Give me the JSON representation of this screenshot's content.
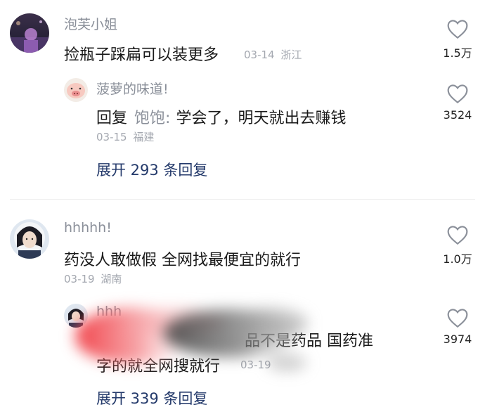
{
  "comments": [
    {
      "username": "泡芙小姐",
      "text": "捡瓶子踩扁可以装更多",
      "date": "03-14",
      "location": "浙江",
      "likes": "1.5万",
      "reply": {
        "username": "菠萝的味道!",
        "reply_label": "回复",
        "reply_to": "饱饱:",
        "text": "学会了，明天就出去赚钱",
        "date": "03-15",
        "location": "福建",
        "likes": "3524"
      },
      "expand_label": "展开 293 条回复"
    },
    {
      "username": "hhhhh!",
      "text": "药没人敢做假 全网找最便宜的就行",
      "date": "03-19",
      "location": "湖南",
      "likes": "1.0万",
      "reply": {
        "username_partial": "hhh",
        "line1_visible": "品不是药品 国药准",
        "line2_visible": "字的就全网搜就行",
        "date_partial": "03-19",
        "likes": "3974"
      },
      "expand_label": "展开 339 条回复"
    }
  ],
  "icons": {
    "like": "heart-outline-icon"
  },
  "colors": {
    "name": "#8a8f99",
    "text": "#1a1a1a",
    "meta": "#a4a8b0",
    "expand": "#243a6b",
    "smudge_red": "#f0353d",
    "smudge_gray": "#555555"
  }
}
